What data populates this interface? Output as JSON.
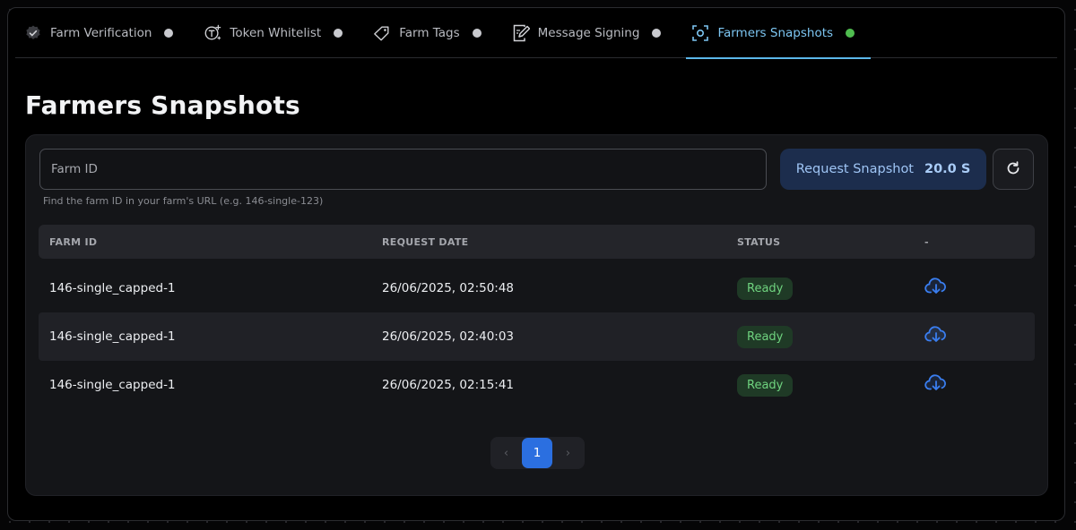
{
  "tabs": [
    {
      "label": "Farm Verification",
      "icon": "verified-badge-icon",
      "active": false
    },
    {
      "label": "Token Whitelist",
      "icon": "token-add-icon",
      "active": false
    },
    {
      "label": "Farm Tags",
      "icon": "tag-icon",
      "active": false
    },
    {
      "label": "Message Signing",
      "icon": "signature-icon",
      "active": false
    },
    {
      "label": "Farmers Snapshots",
      "icon": "snapshot-icon",
      "active": true
    }
  ],
  "page_title": "Farmers Snapshots",
  "form": {
    "farm_id_placeholder": "Farm ID",
    "farm_id_value": "",
    "hint": "Find the farm ID in your farm's URL (e.g. 146-single-123)",
    "request_label": "Request Snapshot",
    "request_cost": "20.0 S"
  },
  "table": {
    "headers": [
      "FARM ID",
      "REQUEST DATE",
      "STATUS",
      "-"
    ],
    "rows": [
      {
        "farm_id": "146-single_capped-1",
        "date": "26/06/2025, 02:50:48",
        "status": "Ready"
      },
      {
        "farm_id": "146-single_capped-1",
        "date": "26/06/2025, 02:40:03",
        "status": "Ready"
      },
      {
        "farm_id": "146-single_capped-1",
        "date": "26/06/2025, 02:15:41",
        "status": "Ready"
      }
    ]
  },
  "pagination": {
    "prev": "‹",
    "current": "1",
    "next": "›"
  },
  "colors": {
    "accent": "#5bb7ea",
    "status_ready": "#6fd37f",
    "primary_button": "#2b6fe0",
    "download_icon": "#3a7ef0"
  }
}
